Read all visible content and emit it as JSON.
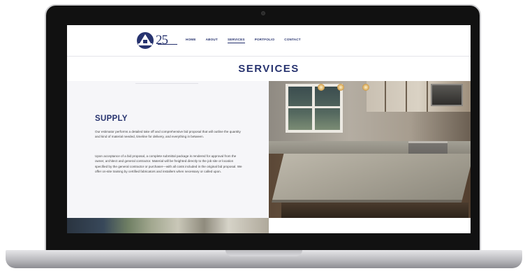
{
  "brand": {
    "anniversary_text": "25",
    "accent_color": "#27336f"
  },
  "nav": {
    "items": [
      {
        "label": "HOME",
        "active": false
      },
      {
        "label": "ABOUT",
        "active": false
      },
      {
        "label": "SERVICES",
        "active": true
      },
      {
        "label": "PORTFOLIO",
        "active": false
      },
      {
        "label": "CONTACT",
        "active": false
      }
    ]
  },
  "page": {
    "title": "SERVICES"
  },
  "section": {
    "title": "SUPPLY",
    "paragraph1": "Our estimator performs a detailed take off and comprehensive bid proposal that will outline the quantity and kind of material needed, timeline for delivery, and everything in between.",
    "paragraph2": "Upon acceptance of a bid proposal, a complete submittal package is rendered for approval from the owner, architect and general contractor. Material will be freighted directly to the job site or location specified by the general contractor or purchaser—with all costs included in the original bid proposal. We offer on-site training by certified fabricators and installers when necessary or called upon."
  },
  "images": {
    "hero": "kitchen-countertop-photo",
    "strip": "stone-slab-samples-photo"
  }
}
